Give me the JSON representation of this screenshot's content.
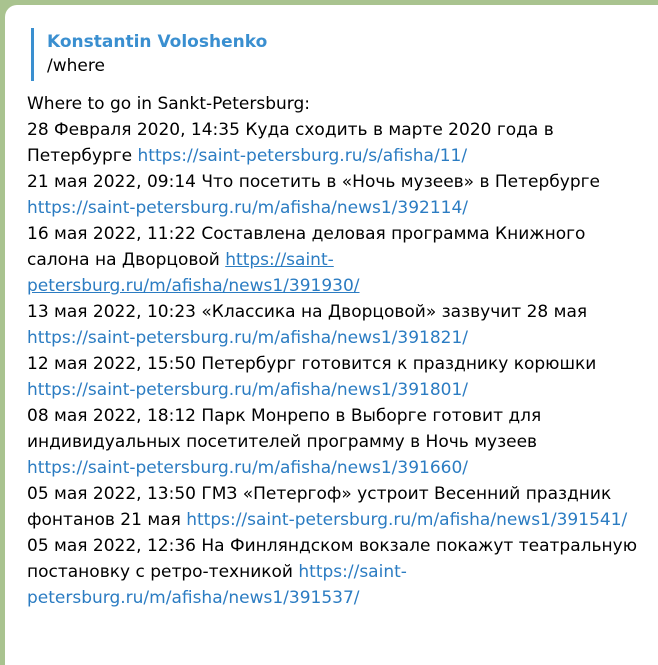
{
  "reply": {
    "author": "Konstantin Voloshenko",
    "text": "/where"
  },
  "message": {
    "intro": "Where to go in Sankt-Petersburg:",
    "entries": [
      {
        "text": "28 Февраля 2020, 14:35 Куда сходить в марте 2020 года в Петербурге ",
        "link": "https://saint-petersburg.ru/s/afisha/11/",
        "hover": false
      },
      {
        "text": "21 мая 2022, 09:14 Что посетить в «Ночь музеев» в Петербурге ",
        "link": "https://saint-petersburg.ru/m/afisha/news1/392114/",
        "hover": false
      },
      {
        "text": "16 мая 2022, 11:22 Составлена деловая программа Книжного салона на Дворцовой ",
        "link": "https://saint-petersburg.ru/m/afisha/news1/391930/",
        "hover": true
      },
      {
        "text": "13 мая 2022, 10:23 «Классика на Дворцовой» зазвучит 28 мая ",
        "link": "https://saint-petersburg.ru/m/afisha/news1/391821/",
        "hover": false
      },
      {
        "text": "12 мая 2022, 15:50 Петербург готовится к празднику корюшки ",
        "link": "https://saint-petersburg.ru/m/afisha/news1/391801/",
        "hover": false
      },
      {
        "text": "08 мая 2022, 18:12 Парк Монрепо в Выборге готовит для индивидуальных посетителей программу в Ночь музеев ",
        "link": "https://saint-petersburg.ru/m/afisha/news1/391660/",
        "hover": false
      },
      {
        "text": "05 мая 2022, 13:50 ГМЗ «Петергоф» устроит Весенний праздник фонтанов 21 мая ",
        "link": "https://saint-petersburg.ru/m/afisha/news1/391541/",
        "hover": false
      },
      {
        "text": "05 мая 2022, 12:36 На Финляндском вокзале покажут театральную постановку с ретро-техникой ",
        "link": "https://saint-petersburg.ru/m/afisha/news1/391537/",
        "hover": false
      }
    ]
  },
  "colors": {
    "background": "#a9c38f",
    "bubble": "#ffffff",
    "accent": "#3a8fd0",
    "link": "#2b7cc2"
  }
}
